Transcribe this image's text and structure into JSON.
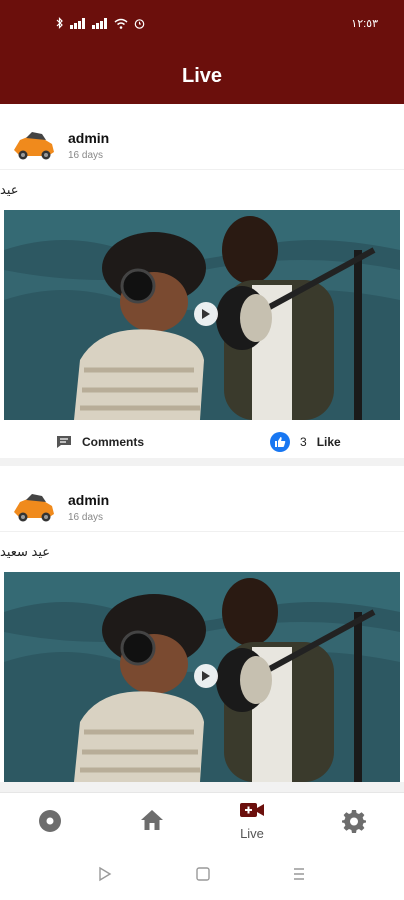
{
  "status": {
    "time": "١٢:٥٣"
  },
  "header": {
    "title": "Live"
  },
  "posts": [
    {
      "author": "admin",
      "time": "16 days",
      "text": "عيد",
      "comments_label": "Comments",
      "like_count": "3",
      "like_label": "Like"
    },
    {
      "author": "admin",
      "time": "16 days",
      "text": "عيد سعيد"
    }
  ],
  "nav": {
    "live_label": "Live"
  },
  "colors": {
    "brand": "#6b0f0c",
    "like": "#1877f2"
  }
}
